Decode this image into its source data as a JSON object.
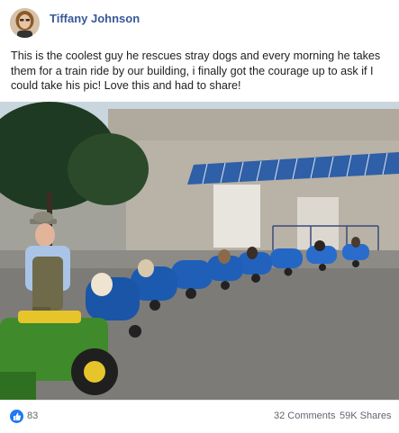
{
  "post": {
    "author": "Tiffany Johnson",
    "text": "This is the coolest guy he rescues stray dogs and every morning he takes them for a train ride by our building, i finally got the courage up to ask if I could take his pic! Love this and had to share!",
    "image_alt": "Man on a green riding mower pulling a train of blue barrel carts carrying dogs in a parking lot"
  },
  "stats": {
    "reaction_icon": "thumbs-up-icon",
    "likes": "83",
    "comments": "32 Comments",
    "shares": "59K Shares"
  },
  "colors": {
    "author_link": "#385898",
    "like_blue": "#2078f4",
    "barrel_blue": "#1f5fb8",
    "mower_green": "#3f8a2a"
  }
}
